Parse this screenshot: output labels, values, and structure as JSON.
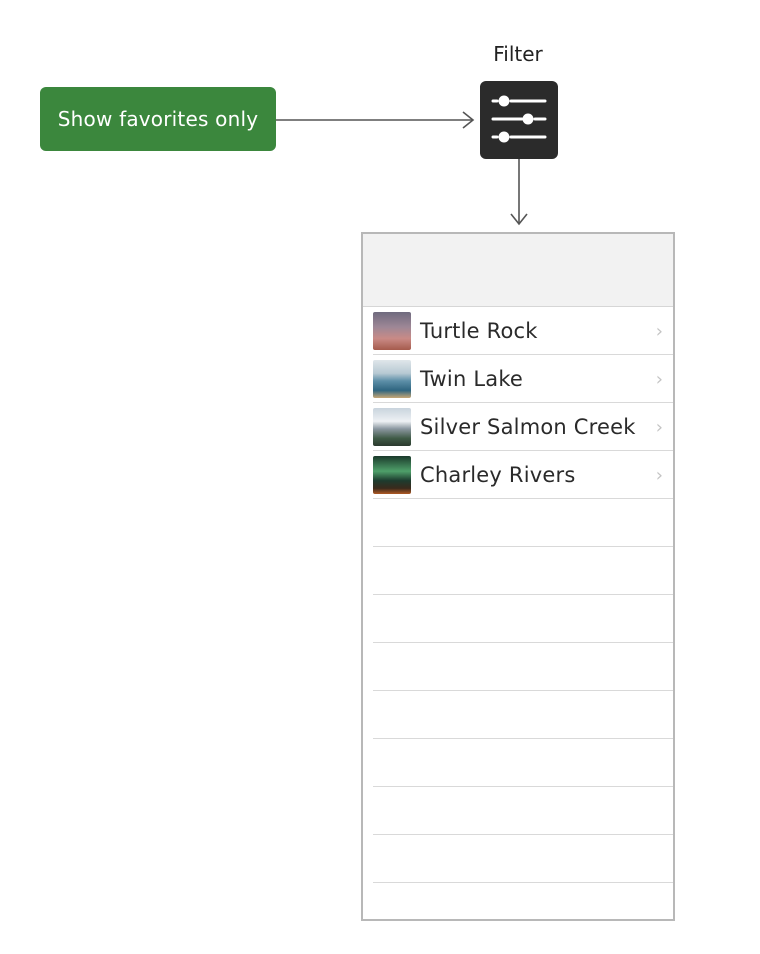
{
  "favorites_button": {
    "label": "Show favorites only"
  },
  "filter": {
    "caption": "Filter",
    "icon": "sliders-icon"
  },
  "list": {
    "items": [
      {
        "label": "Turtle Rock"
      },
      {
        "label": "Twin Lake"
      },
      {
        "label": "Silver Salmon Creek"
      },
      {
        "label": "Charley Rivers"
      }
    ],
    "chevron_icon": "chevron-right-icon"
  },
  "colors": {
    "button_green": "#3b873d",
    "icon_background": "#2b2b2b",
    "connector": "#555555"
  }
}
